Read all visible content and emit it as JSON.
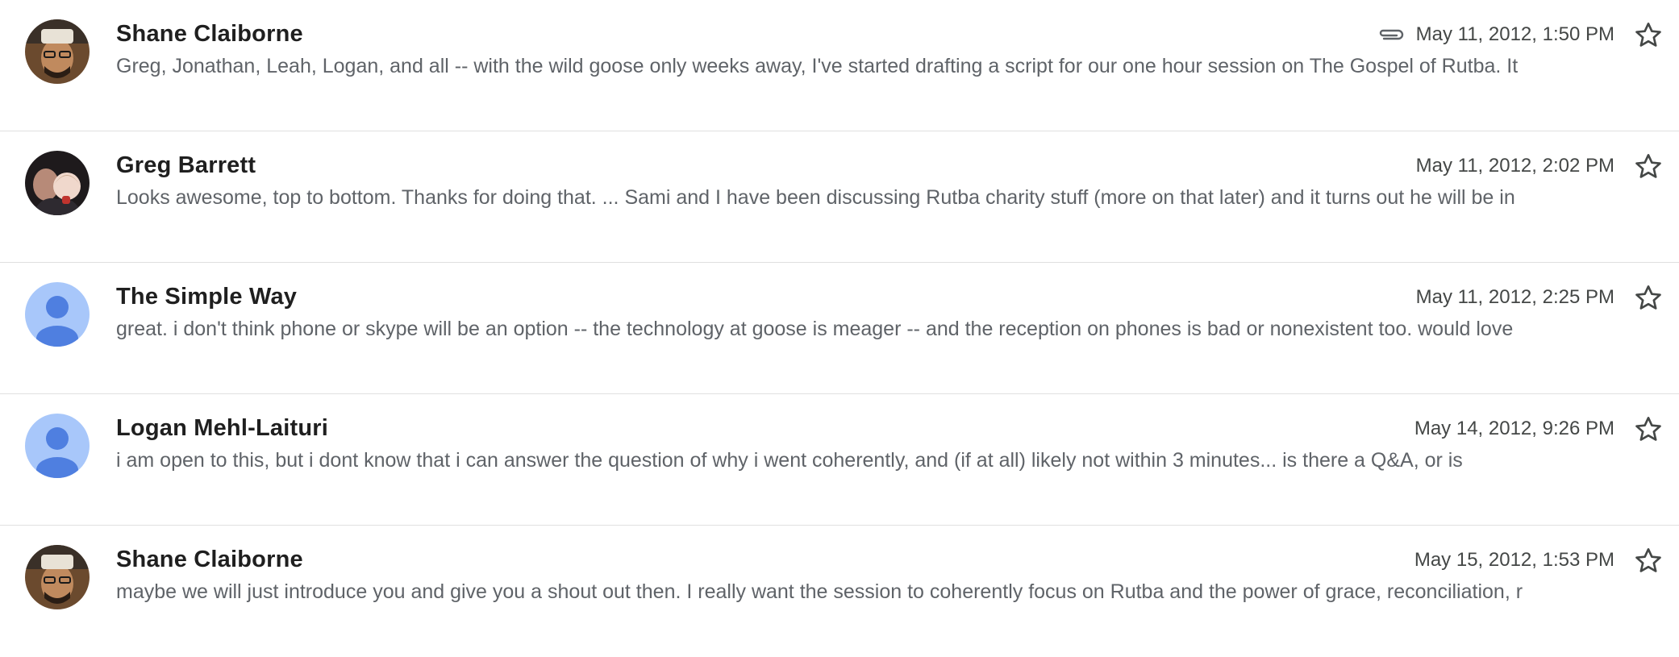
{
  "messages": [
    {
      "sender": "Shane Claiborne",
      "date": "May 11, 2012, 1:50 PM",
      "snippet": "Greg, Jonathan, Leah, Logan, and all -- with the wild goose only weeks away, I've started drafting a script for our one hour session on The Gospel of Rutba. It",
      "has_attachment": true,
      "avatar": "photo-shane"
    },
    {
      "sender": "Greg Barrett",
      "date": "May 11, 2012, 2:02 PM",
      "snippet": "Looks awesome, top to bottom. Thanks for doing that. ... Sami and I have been discussing Rutba charity stuff (more on that later) and it turns out he will be in",
      "has_attachment": false,
      "avatar": "photo-greg"
    },
    {
      "sender": "The Simple Way",
      "date": "May 11, 2012, 2:25 PM",
      "snippet": "great. i don't think phone or skype will be an option -- the technology at goose is meager -- and the reception on phones is bad or nonexistent too. would love",
      "has_attachment": false,
      "avatar": "default-person"
    },
    {
      "sender": "Logan Mehl-Laituri",
      "date": "May 14, 2012, 9:26 PM",
      "snippet": "i am open to this, but i dont know that i can answer the question of why i went coherently, and (if at all) likely not within 3 minutes... is there a Q&A, or is",
      "has_attachment": false,
      "avatar": "default-person"
    },
    {
      "sender": "Shane Claiborne",
      "date": "May 15, 2012, 1:53 PM",
      "snippet": "maybe we will just introduce you and give you a shout out then. I really want the session to coherently focus on Rutba and the power of grace, reconciliation, r",
      "has_attachment": false,
      "avatar": "photo-shane"
    }
  ],
  "icons": {
    "attachment": "paperclip-icon",
    "star": "star-outline-icon"
  },
  "colors": {
    "default_avatar_bg": "#a8c7fa",
    "default_avatar_fg": "#4f7fe0",
    "snippet": "#5f6368",
    "divider": "#e0e0e0"
  }
}
